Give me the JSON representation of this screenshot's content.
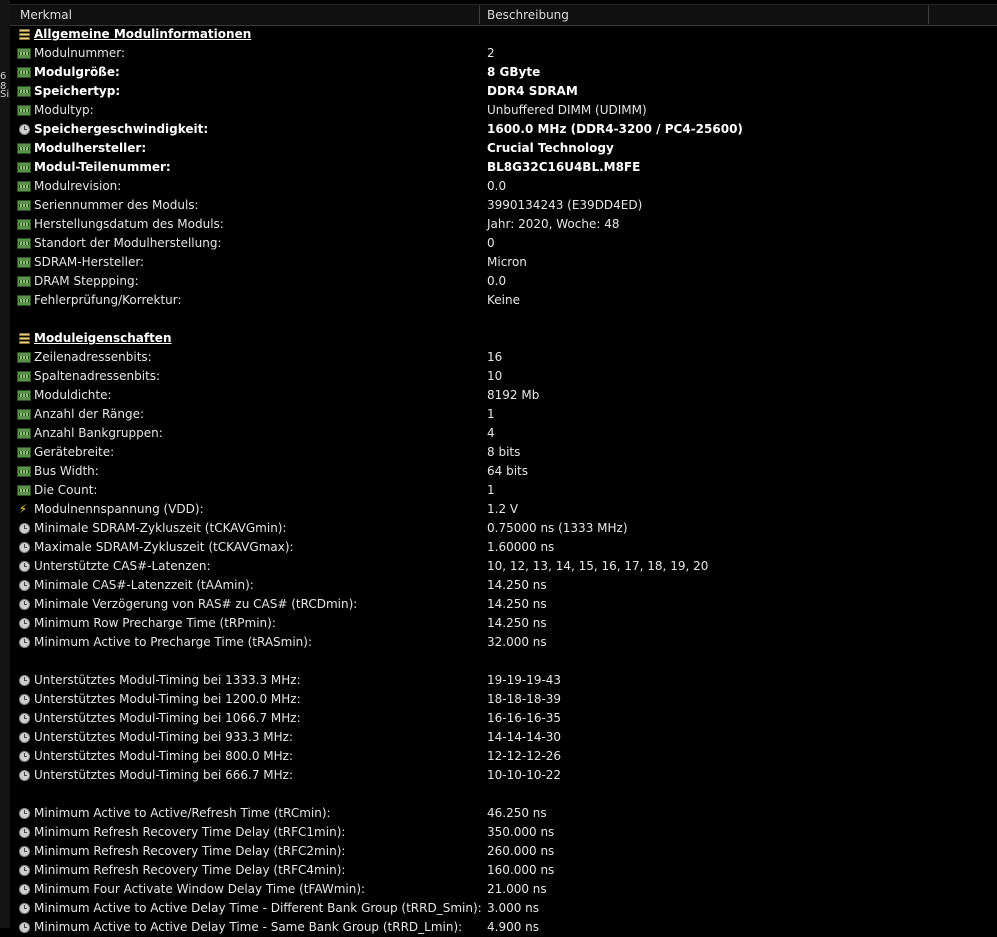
{
  "header": {
    "col1": "Merkmal",
    "col2": "Beschreibung"
  },
  "left_strip": [
    "6",
    "8",
    "Si"
  ],
  "rows": [
    {
      "icon": "database",
      "label": "Allgemeine Modulinformationen",
      "value": "",
      "style": "section"
    },
    {
      "icon": "ram",
      "label": "Modulnummer:",
      "value": "2",
      "style": ""
    },
    {
      "icon": "ram",
      "label": "Modulgröße:",
      "value": "8 GByte",
      "style": "bold"
    },
    {
      "icon": "ram",
      "label": "Speichertyp:",
      "value": "DDR4 SDRAM",
      "style": "bold"
    },
    {
      "icon": "ram",
      "label": "Modultyp:",
      "value": "Unbuffered DIMM (UDIMM)",
      "style": ""
    },
    {
      "icon": "clock",
      "label": "Speichergeschwindigkeit:",
      "value": "1600.0 MHz (DDR4-3200 / PC4-25600)",
      "style": "bold"
    },
    {
      "icon": "ram",
      "label": "Modulhersteller:",
      "value": "Crucial Technology",
      "style": "bold"
    },
    {
      "icon": "ram",
      "label": "Modul-Teilenummer:",
      "value": "BL8G32C16U4BL.M8FE",
      "style": "bold"
    },
    {
      "icon": "ram",
      "label": "Modulrevision:",
      "value": "0.0",
      "style": ""
    },
    {
      "icon": "ram",
      "label": "Seriennummer des Moduls:",
      "value": "3990134243 (E39DD4ED)",
      "style": ""
    },
    {
      "icon": "ram",
      "label": "Herstellungsdatum des Moduls:",
      "value": "Jahr: 2020, Woche: 48",
      "style": ""
    },
    {
      "icon": "ram",
      "label": "Standort der Modulherstellung:",
      "value": "0",
      "style": ""
    },
    {
      "icon": "ram",
      "label": "SDRAM-Hersteller:",
      "value": "Micron",
      "style": ""
    },
    {
      "icon": "ram",
      "label": "DRAM Steppping:",
      "value": "0.0",
      "style": ""
    },
    {
      "icon": "ram",
      "label": "Fehlerprüfung/Korrektur:",
      "value": "Keine",
      "style": ""
    },
    {
      "icon": "",
      "label": "",
      "value": "",
      "style": "blank"
    },
    {
      "icon": "database",
      "label": "Moduleigenschaften",
      "value": "",
      "style": "section"
    },
    {
      "icon": "ram",
      "label": "Zeilenadressenbits:",
      "value": "16",
      "style": ""
    },
    {
      "icon": "ram",
      "label": "Spaltenadressenbits:",
      "value": "10",
      "style": ""
    },
    {
      "icon": "ram",
      "label": "Moduldichte:",
      "value": "8192 Mb",
      "style": ""
    },
    {
      "icon": "ram",
      "label": "Anzahl der Ränge:",
      "value": "1",
      "style": ""
    },
    {
      "icon": "ram",
      "label": "Anzahl Bankgruppen:",
      "value": "4",
      "style": ""
    },
    {
      "icon": "ram",
      "label": "Gerätebreite:",
      "value": "8 bits",
      "style": ""
    },
    {
      "icon": "ram",
      "label": "Bus Width:",
      "value": "64 bits",
      "style": ""
    },
    {
      "icon": "ram",
      "label": "Die Count:",
      "value": "1",
      "style": ""
    },
    {
      "icon": "bolt",
      "label": "Modulnennspannung (VDD):",
      "value": "1.2 V",
      "style": ""
    },
    {
      "icon": "clock",
      "label": "Minimale SDRAM-Zykluszeit (tCKAVGmin):",
      "value": "0.75000 ns (1333 MHz)",
      "style": ""
    },
    {
      "icon": "clock",
      "label": "Maximale SDRAM-Zykluszeit (tCKAVGmax):",
      "value": "1.60000 ns",
      "style": ""
    },
    {
      "icon": "clock",
      "label": "Unterstützte CAS#-Latenzen:",
      "value": "10, 12, 13, 14, 15, 16, 17, 18, 19, 20",
      "style": ""
    },
    {
      "icon": "clock",
      "label": "Minimale CAS#-Latenzzeit (tAAmin):",
      "value": "14.250 ns",
      "style": ""
    },
    {
      "icon": "clock",
      "label": "Minimale Verzögerung von RAS# zu CAS# (tRCDmin):",
      "value": "14.250 ns",
      "style": ""
    },
    {
      "icon": "clock",
      "label": "Minimum Row Precharge Time (tRPmin):",
      "value": "14.250 ns",
      "style": ""
    },
    {
      "icon": "clock",
      "label": "Minimum Active to Precharge Time (tRASmin):",
      "value": "32.000 ns",
      "style": ""
    },
    {
      "icon": "",
      "label": "",
      "value": "",
      "style": "blank"
    },
    {
      "icon": "clock",
      "label": "Unterstütztes Modul-Timing bei 1333.3 MHz:",
      "value": "19-19-19-43",
      "style": ""
    },
    {
      "icon": "clock",
      "label": "Unterstütztes Modul-Timing bei 1200.0 MHz:",
      "value": "18-18-18-39",
      "style": ""
    },
    {
      "icon": "clock",
      "label": "Unterstütztes Modul-Timing bei 1066.7 MHz:",
      "value": "16-16-16-35",
      "style": ""
    },
    {
      "icon": "clock",
      "label": "Unterstütztes Modul-Timing bei 933.3 MHz:",
      "value": "14-14-14-30",
      "style": ""
    },
    {
      "icon": "clock",
      "label": "Unterstütztes Modul-Timing bei 800.0 MHz:",
      "value": "12-12-12-26",
      "style": ""
    },
    {
      "icon": "clock",
      "label": "Unterstütztes Modul-Timing bei 666.7 MHz:",
      "value": "10-10-10-22",
      "style": ""
    },
    {
      "icon": "",
      "label": "",
      "value": "",
      "style": "blank"
    },
    {
      "icon": "clock",
      "label": "Minimum Active to Active/Refresh Time (tRCmin):",
      "value": "46.250 ns",
      "style": ""
    },
    {
      "icon": "clock",
      "label": "Minimum Refresh Recovery Time Delay (tRFC1min):",
      "value": "350.000 ns",
      "style": ""
    },
    {
      "icon": "clock",
      "label": "Minimum Refresh Recovery Time Delay (tRFC2min):",
      "value": "260.000 ns",
      "style": ""
    },
    {
      "icon": "clock",
      "label": "Minimum Refresh Recovery Time Delay (tRFC4min):",
      "value": "160.000 ns",
      "style": ""
    },
    {
      "icon": "clock",
      "label": "Minimum Four Activate Window Delay Time (tFAWmin):",
      "value": "21.000 ns",
      "style": ""
    },
    {
      "icon": "clock",
      "label": "Minimum Active to Active Delay Time - Different Bank Group (tRRD_Smin):",
      "value": "3.000 ns",
      "style": ""
    },
    {
      "icon": "clock",
      "label": "Minimum Active to Active Delay Time - Same Bank Group (tRRD_Lmin):",
      "value": "4.900 ns",
      "style": ""
    }
  ]
}
